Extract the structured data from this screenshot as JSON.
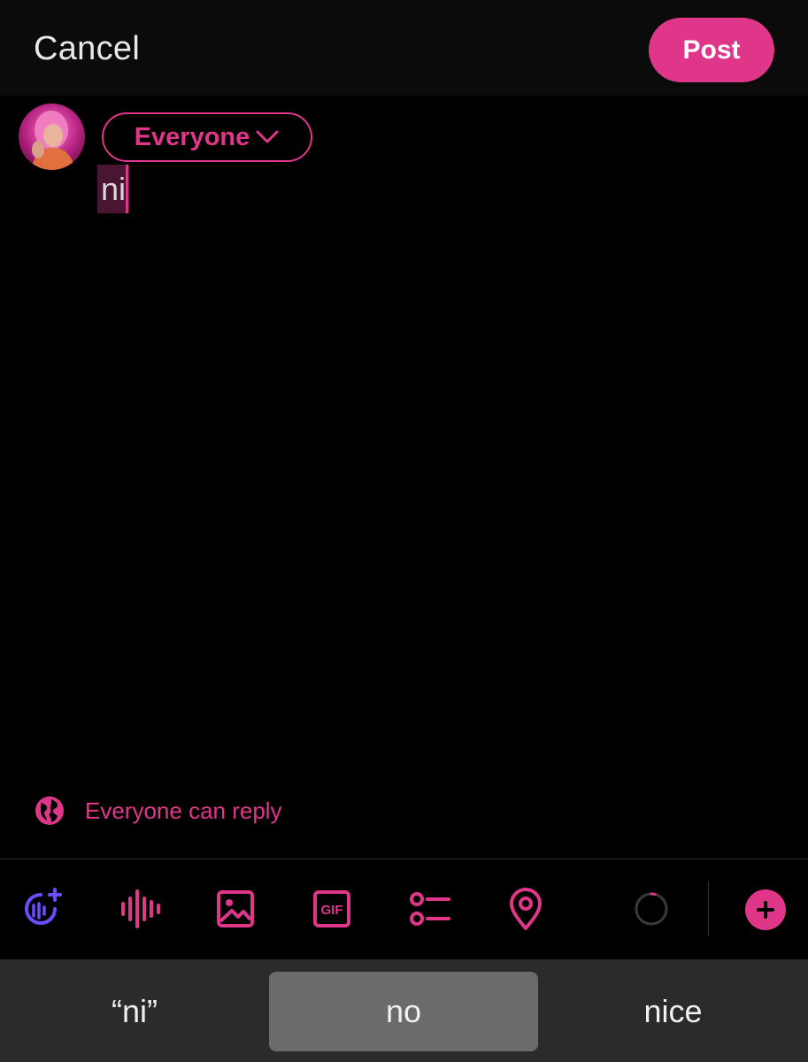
{
  "header": {
    "cancel_label": "Cancel",
    "post_label": "Post"
  },
  "composer": {
    "audience_label": "Everyone",
    "text_value": "ni"
  },
  "reply_setting": {
    "label": "Everyone can reply",
    "icon": "globe-icon"
  },
  "toolbar": {
    "icons": [
      "grok-add-icon",
      "audio-waveform-icon",
      "image-icon",
      "gif-icon",
      "poll-icon",
      "location-pin-icon",
      "character-count-ring-icon",
      "add-thread-icon"
    ]
  },
  "keyboard": {
    "suggestions": [
      "“ni”",
      "no",
      "nice"
    ],
    "selected_index": 1
  },
  "colors": {
    "accent": "#e0368a",
    "grok_accent": "#6a4cff",
    "background": "#000000",
    "keyboard_bg": "#2b2b2b"
  }
}
